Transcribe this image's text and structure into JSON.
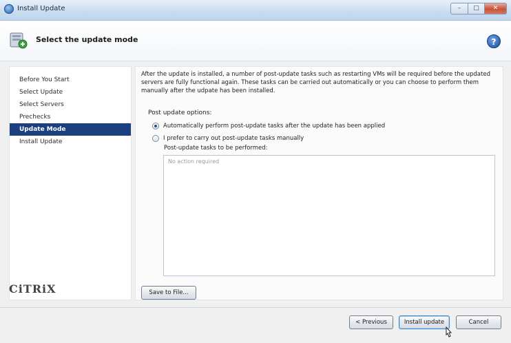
{
  "window": {
    "title": "Install Update",
    "controls": {
      "minimize": "–",
      "maximize": "□",
      "close": "✕"
    }
  },
  "header": {
    "title": "Select the update mode",
    "help_symbol": "?"
  },
  "nav": {
    "items": [
      {
        "label": "Before You Start",
        "active": false
      },
      {
        "label": "Select Update",
        "active": false
      },
      {
        "label": "Select Servers",
        "active": false
      },
      {
        "label": "Prechecks",
        "active": false
      },
      {
        "label": "Update Mode",
        "active": true
      },
      {
        "label": "Install Update",
        "active": false
      }
    ],
    "logo": "CiTRiX"
  },
  "content": {
    "intro": "After the update is installed, a number of post-update tasks such as restarting VMs will be required before the updated servers are fully functional again. These tasks can be carried out automatically or you can choose to perform them manually after the udpate has been installed.",
    "options_label": "Post update options:",
    "options": [
      {
        "label": "Automatically perform post-update tasks after the update has been applied",
        "selected": true
      },
      {
        "label": "I prefer to carry out post-update tasks manually",
        "selected": false
      }
    ],
    "tasks_label": "Post-update tasks to be performed:",
    "tasks_placeholder": "No action required",
    "save_button": "Save to File..."
  },
  "footer": {
    "previous_button": "< Previous",
    "install_button": "Install update",
    "cancel_button": "Cancel"
  },
  "colors": {
    "nav_active_bg": "#1b3f7f",
    "titlebar": "#c9dcef"
  }
}
